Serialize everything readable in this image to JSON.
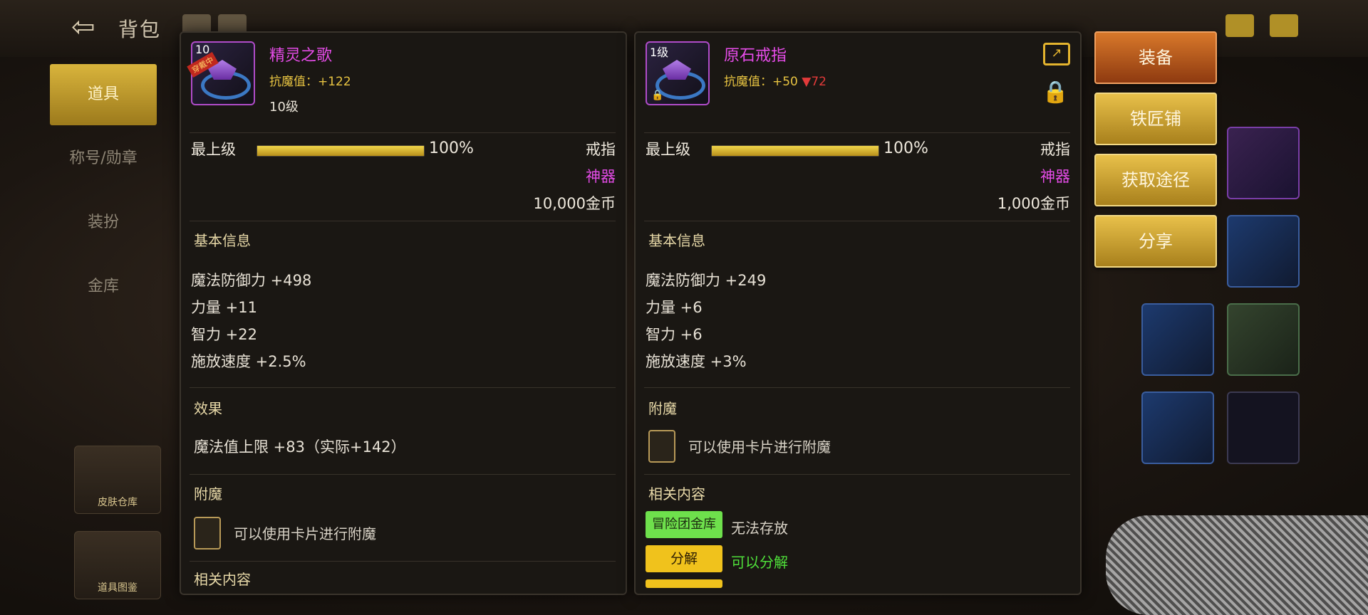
{
  "topbar": {
    "title": "背包"
  },
  "left_nav": {
    "items": [
      "道具",
      "称号/勋章",
      "装扮",
      "金库"
    ]
  },
  "left_bottom": {
    "items": [
      "皮肤仓库",
      "道具图鉴"
    ]
  },
  "equipped_item": {
    "name": "精灵之歌",
    "icon_level": "10",
    "equipped_tag": "穿戴中",
    "stat_line": "抗魔值：+122",
    "level": "10级",
    "grade": "最上级",
    "grade_percent": "100%",
    "grade_fraction": 1.0,
    "type": "戒指",
    "rarity": "神器",
    "price": "10,000金币",
    "basic_info_title": "基本信息",
    "stats": [
      "魔法防御力 +498",
      "力量 +11",
      "智力 +22",
      "施放速度 +2.5%"
    ],
    "effect_title": "效果",
    "effect": "魔法值上限 +83（实际+142）",
    "enchant_title": "附魔",
    "enchant_text": "可以使用卡片进行附魔",
    "related_title": "相关内容"
  },
  "compare_item": {
    "name": "原石戒指",
    "icon_level": "1级",
    "stat_prefix": "抗魔值：+50",
    "stat_diff": "▼72",
    "grade": "最上级",
    "grade_percent": "100%",
    "grade_fraction": 1.0,
    "type": "戒指",
    "rarity": "神器",
    "price": "1,000金币",
    "basic_info_title": "基本信息",
    "stats": [
      "魔法防御力 +249",
      "力量 +6",
      "智力 +6",
      "施放速度 +3%"
    ],
    "enchant_title": "附魔",
    "enchant_text": "可以使用卡片进行附魔",
    "related_title": "相关内容",
    "related": [
      {
        "tag": "冒险团金库",
        "note": "无法存放",
        "tag_color": "#6ee04c",
        "note_color": "#d8d2c6"
      },
      {
        "tag": "分解",
        "note": "可以分解",
        "tag_color": "#f0c21c",
        "note_color": "#4fe03a"
      }
    ]
  },
  "actions": {
    "equip": "装备",
    "smith": "铁匠铺",
    "source": "获取途径",
    "share": "分享"
  },
  "icons": [
    "back-arrow-icon",
    "share-icon",
    "lock-icon",
    "mail-icon",
    "chat-icon"
  ]
}
